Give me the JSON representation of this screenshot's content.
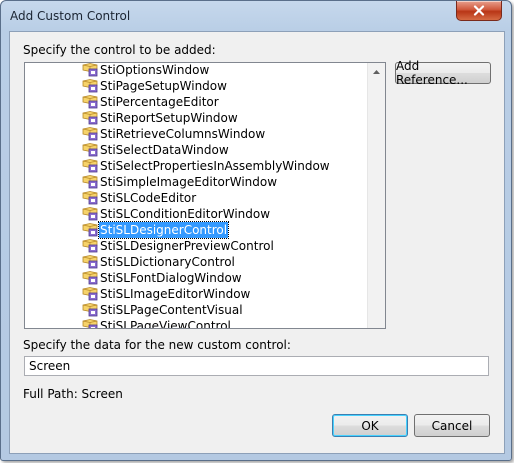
{
  "window": {
    "title": "Add Custom Control",
    "close_icon": "close-icon"
  },
  "dialog": {
    "specify_control_label": "Specify the control to be added:",
    "add_reference_label": "Add Reference...",
    "specify_data_label": "Specify the data for the new custom control:",
    "data_value": "Screen",
    "full_path_label": "Full Path: Screen",
    "ok_label": "OK",
    "cancel_label": "Cancel"
  },
  "controls": {
    "item_icon": "control-class-icon",
    "selected_index": 10,
    "items": [
      "StiOptionsWindow",
      "StiPageSetupWindow",
      "StiPercentageEditor",
      "StiReportSetupWindow",
      "StiRetrieveColumnsWindow",
      "StiSelectDataWindow",
      "StiSelectPropertiesInAssemblyWindow",
      "StiSimpleImageEditorWindow",
      "StiSLCodeEditor",
      "StiSLConditionEditorWindow",
      "StiSLDesignerControl",
      "StiSLDesignerPreviewControl",
      "StiSLDictionaryControl",
      "StiSLFontDialogWindow",
      "StiSLImageEditorWindow",
      "StiSLPageContentVisual",
      "StiSLPageViewControl"
    ]
  },
  "colors": {
    "selection": "#3399ff",
    "frame": "#b9cee6",
    "close_button": "#c74a2a"
  }
}
